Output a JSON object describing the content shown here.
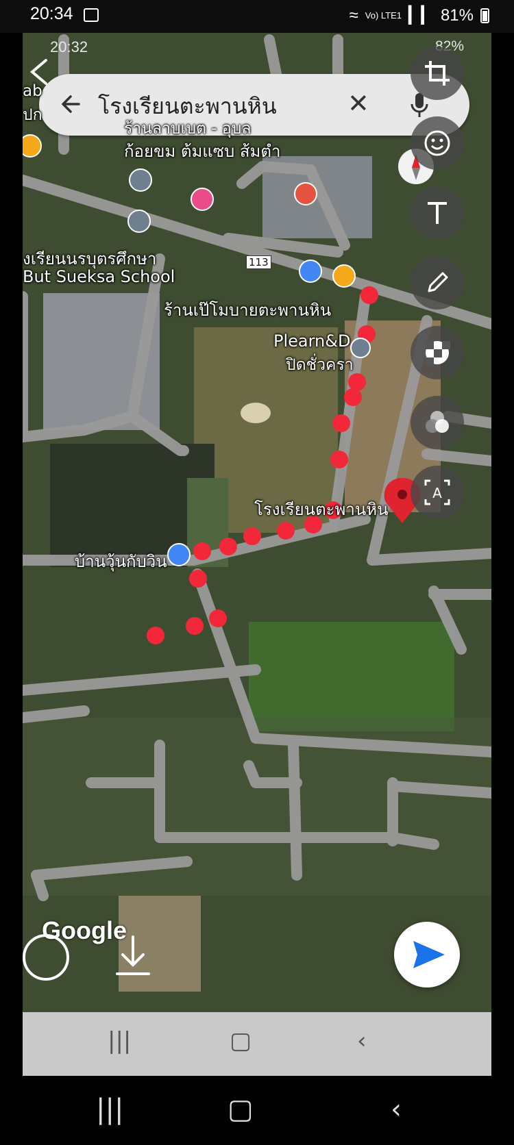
{
  "status_bar": {
    "time": "20:34",
    "signal_text": "Vo) LTE1",
    "battery": "81%"
  },
  "screenshot_status": {
    "time": "20:32",
    "battery": "82%"
  },
  "search": {
    "query": "โรงเรียนตะพานหิน"
  },
  "map_labels": {
    "restaurant_top": "ก้อยขม ต้มแซบ ส้มตำ",
    "restaurant_top_cut": "ร้านลาบเบต - อุบล",
    "school_left_th": "งเรียนนรบุตรศึกษา",
    "school_left_en": "But Sueksa School",
    "shop_mid": "ร้านเป๊โมบายตะพานหิน",
    "plearn": "Plearn&D",
    "plearn_status": "ปิดชั่วครา",
    "target": "โรงเรียนตะพานหิน",
    "shop_bottom": "บ้านวุ้นกับวิน",
    "road_number": "113",
    "left_cut_1": "ab",
    "left_cut_2": "ปก",
    "google": "Google"
  },
  "route_points_count": 16,
  "colors": {
    "route": "#f2283a",
    "marker": "#e0242f",
    "send": "#1a73e8"
  },
  "tools": [
    "crop-icon",
    "emoji-icon",
    "text-icon",
    "pencil-icon",
    "mosaic-icon",
    "filter-icon",
    "extract-text-icon"
  ]
}
